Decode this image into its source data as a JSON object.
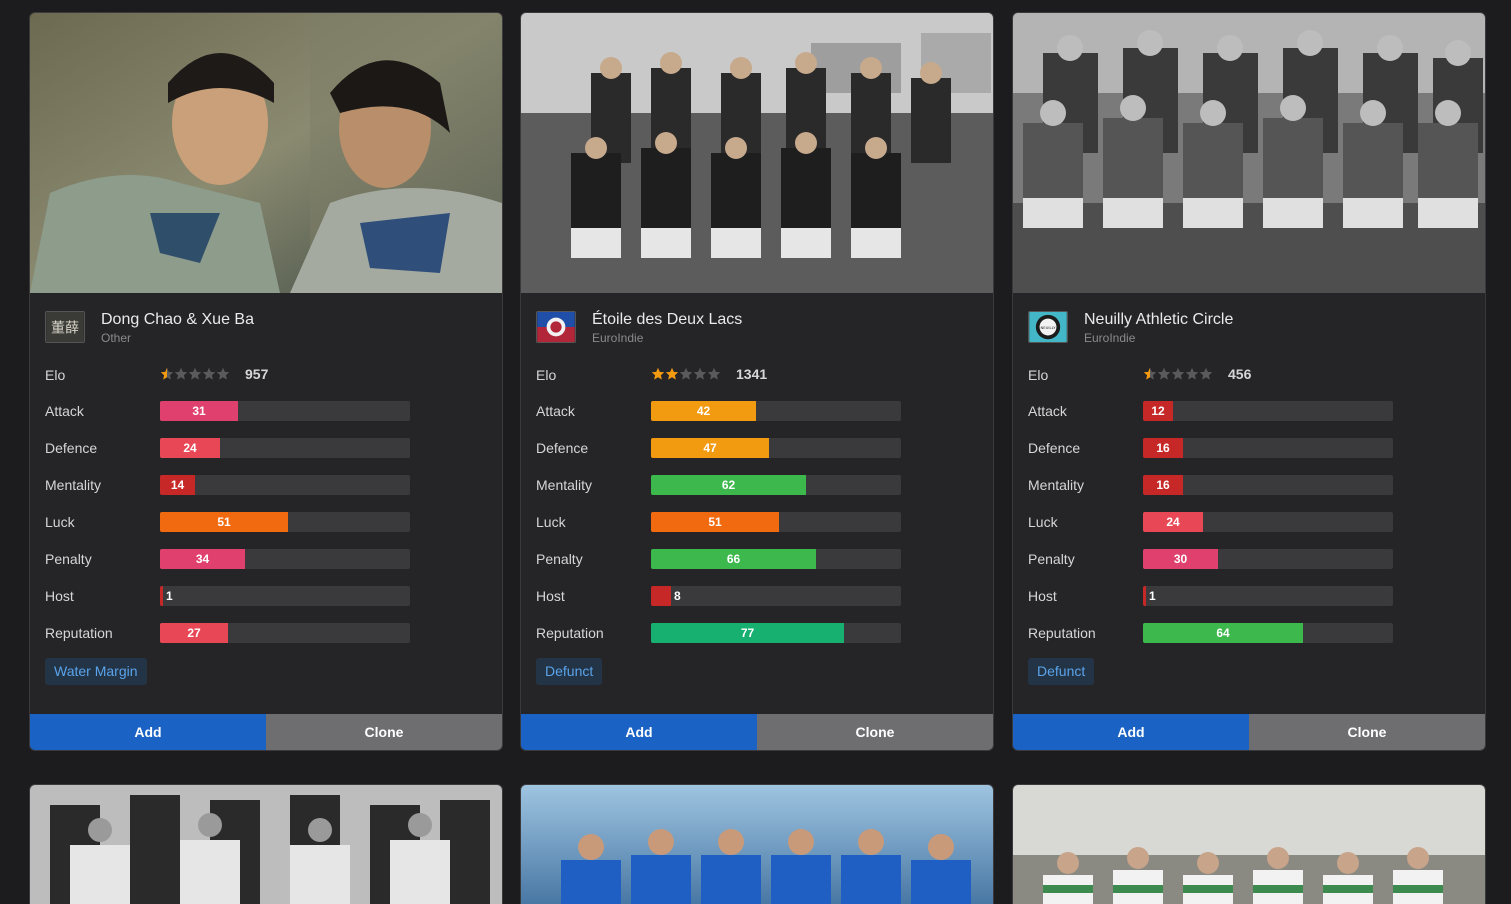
{
  "labels": {
    "elo": "Elo",
    "add": "Add",
    "clone": "Clone"
  },
  "stat_labels": [
    "Attack",
    "Defence",
    "Mentality",
    "Luck",
    "Penalty",
    "Host",
    "Reputation"
  ],
  "colors": {
    "red": "#c62828",
    "light_red": "#e84856",
    "pink": "#e0406e",
    "orange": "#f26a10",
    "amber": "#f29a10",
    "green": "#3cb84c",
    "teal": "#17b070",
    "star_on": "#f29a10",
    "star_off": "#5a5a5e",
    "add_button": "#1a63c4",
    "clone_button": "#6e6e70"
  },
  "cards": [
    {
      "name": "Dong Chao & Xue Ba",
      "league": "Other",
      "logo_text": "董薛",
      "elo": 957,
      "stars": 0.5,
      "stats": [
        {
          "value": 31,
          "color": "pink"
        },
        {
          "value": 24,
          "color": "light_red"
        },
        {
          "value": 14,
          "color": "red"
        },
        {
          "value": 51,
          "color": "orange"
        },
        {
          "value": 34,
          "color": "pink"
        },
        {
          "value": 1,
          "color": "red"
        },
        {
          "value": 27,
          "color": "light_red"
        }
      ],
      "tag": "Water Margin"
    },
    {
      "name": "Étoile des Deux Lacs",
      "league": "EuroIndie",
      "elo": 1341,
      "stars": 2,
      "stats": [
        {
          "value": 42,
          "color": "amber"
        },
        {
          "value": 47,
          "color": "amber"
        },
        {
          "value": 62,
          "color": "green"
        },
        {
          "value": 51,
          "color": "orange"
        },
        {
          "value": 66,
          "color": "green"
        },
        {
          "value": 8,
          "color": "red"
        },
        {
          "value": 77,
          "color": "teal"
        }
      ],
      "tag": "Defunct"
    },
    {
      "name": "Neuilly Athletic Circle",
      "league": "EuroIndie",
      "logo_text": "NEUILLY",
      "elo": 456,
      "stars": 0.5,
      "stats": [
        {
          "value": 12,
          "color": "red"
        },
        {
          "value": 16,
          "color": "red"
        },
        {
          "value": 16,
          "color": "red"
        },
        {
          "value": 24,
          "color": "light_red"
        },
        {
          "value": 30,
          "color": "pink"
        },
        {
          "value": 1,
          "color": "red"
        },
        {
          "value": 64,
          "color": "green"
        }
      ],
      "tag": "Defunct"
    }
  ]
}
